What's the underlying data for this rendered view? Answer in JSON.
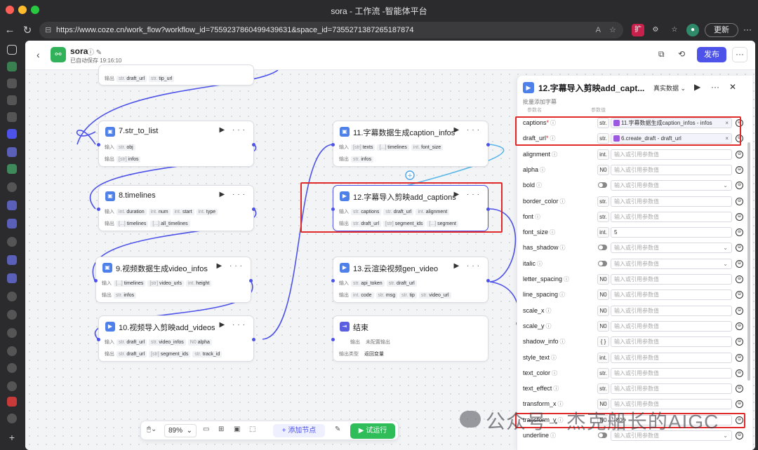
{
  "window": {
    "title": "sora - 工作流 -智能体平台"
  },
  "browser": {
    "url": "https://www.coze.cn/work_flow?workflow_id=7559237860499439631&space_id=7355271387265187874",
    "update_label": "更新",
    "reader_label": "A",
    "more_label": "···"
  },
  "app": {
    "name": "sora",
    "autosave": "已自动保存 19:16:10",
    "publish_label": "发布",
    "more_label": "···"
  },
  "nodes": {
    "top": {
      "out_label": "输出",
      "out": [
        {
          "t": "str.",
          "n": "draft_url"
        },
        {
          "t": "str.",
          "n": "tip_url"
        }
      ]
    },
    "n7": {
      "title": "7.str_to_list",
      "in_label": "输入",
      "out_label": "输出",
      "in": [
        {
          "t": "str.",
          "n": "obj"
        }
      ],
      "out": [
        {
          "t": "[str]",
          "n": "infos"
        }
      ]
    },
    "n8": {
      "title": "8.timelines",
      "in_label": "输入",
      "out_label": "输出",
      "in": [
        {
          "t": "int.",
          "n": "duration"
        },
        {
          "t": "int.",
          "n": "num"
        },
        {
          "t": "int.",
          "n": "start"
        },
        {
          "t": "int.",
          "n": "type"
        }
      ],
      "out": [
        {
          "t": "[...]",
          "n": "timelines"
        },
        {
          "t": "[...]",
          "n": "all_timelines"
        }
      ]
    },
    "n9": {
      "title": "9.视频数据生成video_infos",
      "in_label": "输入",
      "out_label": "输出",
      "in": [
        {
          "t": "[...]",
          "n": "timelines"
        },
        {
          "t": "[str]",
          "n": "video_urls"
        },
        {
          "t": "int.",
          "n": "height"
        }
      ],
      "out": [
        {
          "t": "str.",
          "n": "infos"
        }
      ]
    },
    "n10": {
      "title": "10.视频导入剪映add_videos",
      "in_label": "输入",
      "out_label": "输出",
      "in": [
        {
          "t": "str.",
          "n": "draft_url"
        },
        {
          "t": "str.",
          "n": "video_infos"
        },
        {
          "t": "N0",
          "n": "alpha"
        }
      ],
      "out": [
        {
          "t": "str.",
          "n": "draft_url"
        },
        {
          "t": "[str]",
          "n": "segment_ids"
        },
        {
          "t": "str.",
          "n": "track_id"
        }
      ]
    },
    "n11": {
      "title": "11.字幕数据生成caption_infos",
      "in_label": "输入",
      "out_label": "输出",
      "in": [
        {
          "t": "[str]",
          "n": "texts"
        },
        {
          "t": "[...]",
          "n": "timelines"
        },
        {
          "t": "int.",
          "n": "font_size"
        }
      ],
      "out": [
        {
          "t": "str.",
          "n": "infos"
        }
      ]
    },
    "n12": {
      "title": "12.字幕导入剪映add_captions",
      "in_label": "输入",
      "out_label": "输出",
      "in": [
        {
          "t": "str.",
          "n": "captions"
        },
        {
          "t": "str.",
          "n": "draft_url"
        },
        {
          "t": "int.",
          "n": "alignment"
        }
      ],
      "out": [
        {
          "t": "str.",
          "n": "draft_url"
        },
        {
          "t": "[str]",
          "n": "segment_ids"
        },
        {
          "t": "[...]",
          "n": "segment"
        }
      ]
    },
    "n13": {
      "title": "13.云渲染视频gen_video",
      "in_label": "输入",
      "out_label": "输出",
      "in": [
        {
          "t": "str.",
          "n": "api_token"
        },
        {
          "t": "str.",
          "n": "draft_url"
        }
      ],
      "out": [
        {
          "t": "int.",
          "n": "code"
        },
        {
          "t": "str.",
          "n": "msg"
        },
        {
          "t": "str.",
          "n": "tip"
        },
        {
          "t": "str.",
          "n": "video_url"
        }
      ]
    },
    "end": {
      "title": "结束",
      "out_label": "输出",
      "out_value": "未配置输出",
      "type_label": "输出类型",
      "type_value": "返回变量"
    }
  },
  "toolbar": {
    "zoom": "89%",
    "add_node": "添加节点",
    "run": "试运行"
  },
  "panel": {
    "title": "12.字幕导入剪映add_capt...",
    "mode": "真实数据",
    "subtitle": "批量添加字幕",
    "col_name": "参数名",
    "col_value": "参数值",
    "params": [
      {
        "name": "captions",
        "required": true,
        "type": "str.",
        "kind": "ref",
        "value": "11.字幕数据生成caption_infos - infos"
      },
      {
        "name": "draft_url",
        "required": true,
        "type": "str.",
        "kind": "ref",
        "value": "6.create_draft - draft_url"
      },
      {
        "name": "alignment",
        "type": "int.",
        "kind": "empty",
        "value": "输入或引用参数值"
      },
      {
        "name": "alpha",
        "type": "N0",
        "kind": "empty",
        "value": "输入或引用参数值"
      },
      {
        "name": "bold",
        "type": "toggle",
        "kind": "select",
        "value": "输入或引用参数值"
      },
      {
        "name": "border_color",
        "type": "str.",
        "kind": "empty",
        "value": "输入或引用参数值"
      },
      {
        "name": "font",
        "type": "str.",
        "kind": "empty",
        "value": "输入或引用参数值"
      },
      {
        "name": "font_size",
        "type": "int.",
        "kind": "val",
        "value": "5"
      },
      {
        "name": "has_shadow",
        "type": "toggle",
        "kind": "select",
        "value": "输入或引用参数值"
      },
      {
        "name": "italic",
        "type": "toggle",
        "kind": "select",
        "value": "输入或引用参数值"
      },
      {
        "name": "letter_spacing",
        "type": "N0",
        "kind": "empty",
        "value": "输入或引用参数值"
      },
      {
        "name": "line_spacing",
        "type": "N0",
        "kind": "empty",
        "value": "输入或引用参数值"
      },
      {
        "name": "scale_x",
        "type": "N0",
        "kind": "empty",
        "value": "输入或引用参数值"
      },
      {
        "name": "scale_y",
        "type": "N0",
        "kind": "empty",
        "value": "输入或引用参数值"
      },
      {
        "name": "shadow_info",
        "type": "{ }",
        "kind": "empty",
        "value": "输入或引用参数值"
      },
      {
        "name": "style_text",
        "type": "int.",
        "kind": "empty",
        "value": "输入或引用参数值"
      },
      {
        "name": "text_color",
        "type": "str.",
        "kind": "empty",
        "value": "输入或引用参数值"
      },
      {
        "name": "text_effect",
        "type": "str.",
        "kind": "empty",
        "value": "输入或引用参数值"
      },
      {
        "name": "transform_x",
        "type": "N0",
        "kind": "empty",
        "value": "输入或引用参数值"
      },
      {
        "name": "transform_y",
        "type": "N0",
        "kind": "val",
        "value": "-800"
      },
      {
        "name": "underline",
        "type": "toggle",
        "kind": "select",
        "value": "输入或引用参数值"
      }
    ]
  },
  "watermark": "公众号 · 杰克船长的AIGC"
}
